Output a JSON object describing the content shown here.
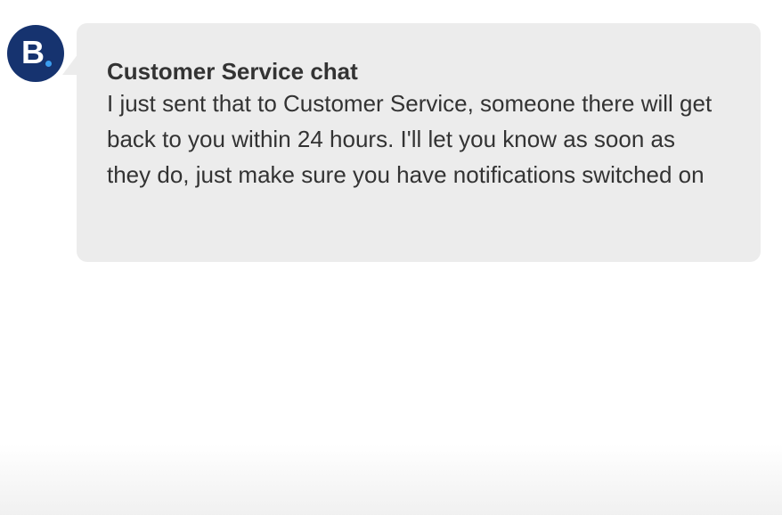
{
  "avatar": {
    "letter": "B",
    "background_color": "#16336f",
    "dot_color": "#3b9ef0"
  },
  "message": {
    "title": "Customer Service chat",
    "body": "I just sent that to Customer Service, someone there will get back to you within 24 hours. I'll let you know as soon as they do, just make sure you have notifications switched on"
  },
  "colors": {
    "bubble_background": "#ececec",
    "text": "#333333"
  }
}
